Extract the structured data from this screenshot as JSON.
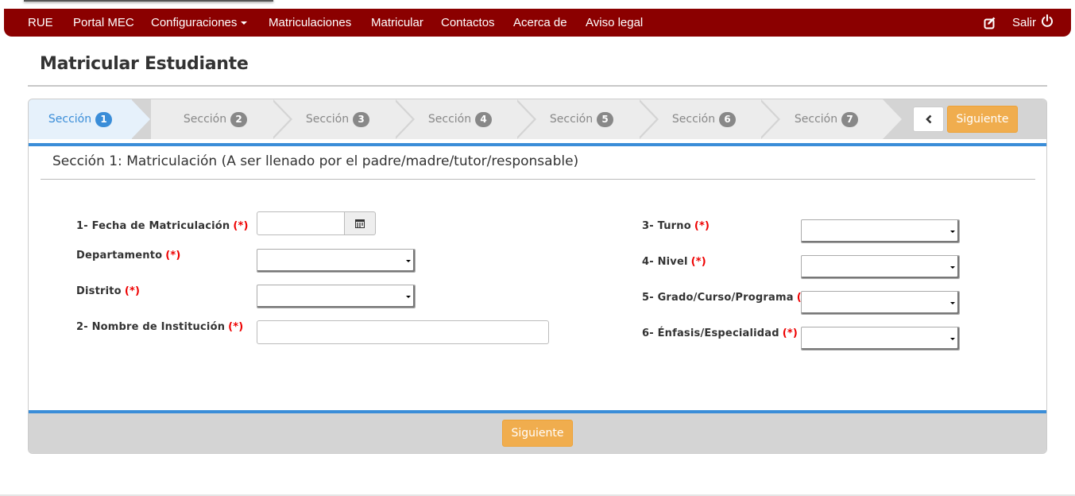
{
  "navbar": {
    "items": [
      {
        "label": "RUE"
      },
      {
        "label": "Portal MEC"
      },
      {
        "label": "Configuraciones"
      },
      {
        "label": "Matriculaciones"
      },
      {
        "label": "Matricular"
      },
      {
        "label": "Contactos"
      },
      {
        "label": "Acerca de"
      },
      {
        "label": "Aviso legal"
      }
    ],
    "edit_icon": "edit-icon",
    "logout_label": "Salir",
    "logout_icon": "power-icon",
    "color": "#8b0000"
  },
  "page": {
    "title": "Matricular Estudiante"
  },
  "wizard": {
    "steps": [
      {
        "label": "Sección",
        "number": "1",
        "active": true
      },
      {
        "label": "Sección",
        "number": "2",
        "active": false
      },
      {
        "label": "Sección",
        "number": "3",
        "active": false
      },
      {
        "label": "Sección",
        "number": "4",
        "active": false
      },
      {
        "label": "Sección",
        "number": "5",
        "active": false
      },
      {
        "label": "Sección",
        "number": "6",
        "active": false
      },
      {
        "label": "Sección",
        "number": "7",
        "active": false
      }
    ],
    "next_label": "Siguiente",
    "footer_next_label": "Siguiente",
    "accent": "#3a8dd8",
    "button_color": "#f0ad4e"
  },
  "section": {
    "title": "Sección 1: Matriculación (A ser llenado por el padre/madre/tutor/responsable)"
  },
  "form": {
    "left": [
      {
        "label": "1- Fecha de Matriculación",
        "required": "(*)",
        "value": ""
      },
      {
        "label": "Departamento",
        "required": "(*)",
        "value": ""
      },
      {
        "label": "Distrito",
        "required": "(*)",
        "value": ""
      },
      {
        "label": "2- Nombre de Institución",
        "required": "(*)",
        "value": ""
      }
    ],
    "right": [
      {
        "label": "3- Turno",
        "required": "(*)",
        "value": ""
      },
      {
        "label": "4- Nivel",
        "required": "(*)",
        "value": ""
      },
      {
        "label": "5- Grado/Curso/Programa",
        "required": "(*)",
        "value": ""
      },
      {
        "label": "6- Énfasis/Especialidad",
        "required": "(*)",
        "value": ""
      }
    ]
  }
}
